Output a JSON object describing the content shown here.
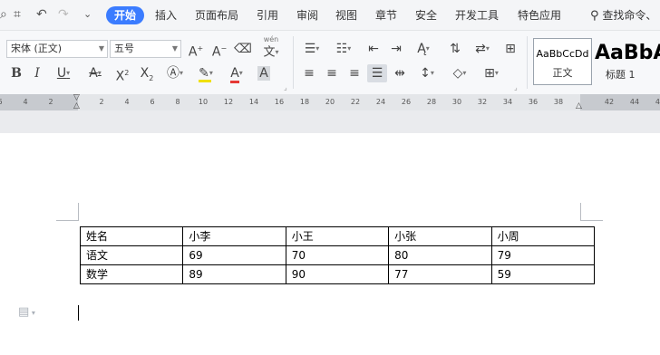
{
  "menu": {
    "tabs": [
      "开始",
      "插入",
      "页面布局",
      "引用",
      "审阅",
      "视图",
      "章节",
      "安全",
      "开发工具",
      "特色应用"
    ],
    "active_tab": "开始",
    "search_label": "查找命令、"
  },
  "ribbon": {
    "font_name": "宋体 (正文)",
    "font_size": "五号",
    "styles": [
      {
        "preview": "AaBbCcDd",
        "name": "正文"
      },
      {
        "preview": "AaBbA",
        "name": "标题 1"
      }
    ],
    "pinyin_glyph": "wén"
  },
  "ruler": {
    "ticks": [
      "6",
      "4",
      "2",
      "",
      "2",
      "4",
      "6",
      "8",
      "10",
      "12",
      "14",
      "16",
      "18",
      "20",
      "22",
      "24",
      "26",
      "28",
      "30",
      "32",
      "34",
      "36",
      "38",
      "",
      "42",
      "44",
      "46"
    ]
  },
  "table": {
    "rows": [
      [
        "姓名",
        "小李",
        "小王",
        "小张",
        "小周"
      ],
      [
        "语文",
        "69",
        "70",
        "80",
        "79"
      ],
      [
        "数学",
        "89",
        "90",
        "77",
        "59"
      ]
    ]
  },
  "colors": {
    "accent": "#3b7cff",
    "font_color_underline": "#e53935",
    "highlight": "#f0e000",
    "text_fill_underline": "#4caf50"
  }
}
